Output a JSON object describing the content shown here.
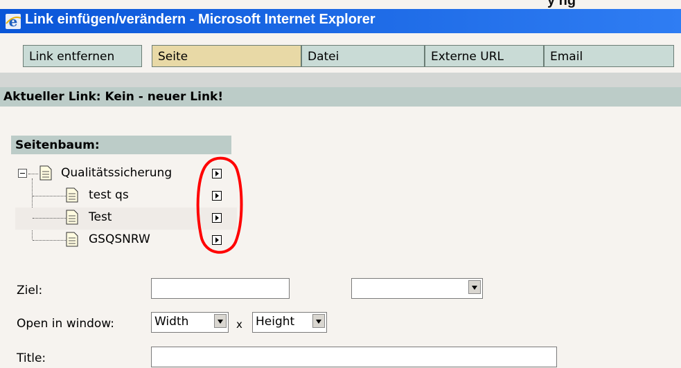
{
  "window": {
    "title": "Link einfügen/verändern - Microsoft Internet Explorer",
    "top_fragment": "y ng"
  },
  "tabs": [
    {
      "label": "Link entfernen"
    },
    {
      "label": "Seite"
    },
    {
      "label": "Datei"
    },
    {
      "label": "Externe URL"
    },
    {
      "label": "Email"
    }
  ],
  "current_link": "Aktueller Link: Kein - neuer Link!",
  "tree": {
    "header": "Seitenbaum:",
    "nodes": [
      {
        "label": "Qualitätssicherung"
      },
      {
        "label": "test qs"
      },
      {
        "label": "Test"
      },
      {
        "label": "GSQSNRW"
      }
    ]
  },
  "form": {
    "target_label": "Ziel:",
    "target_value": "",
    "target_select": "",
    "open_window_label": "Open in window:",
    "width_select": "Width",
    "x_sep": "x",
    "height_select": "Height",
    "title_label": "Title:",
    "title_value": ""
  },
  "colors": {
    "titlebar": "#0a56d8",
    "tab": "#c9dbd6",
    "active_tab": "#e8d9a6",
    "header_band": "#bcccc8",
    "annotation": "#ff0000"
  }
}
